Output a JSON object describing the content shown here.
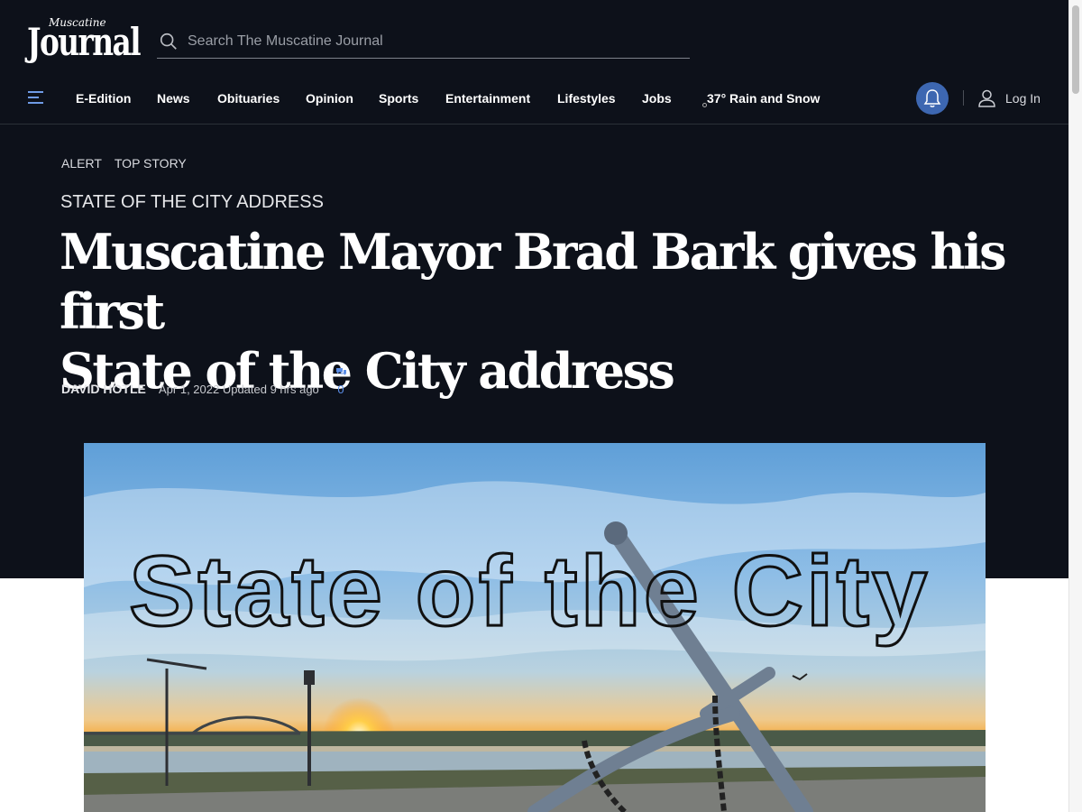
{
  "site": {
    "logo_small": "Muscatine",
    "logo_big": "Journal"
  },
  "search": {
    "placeholder": "Search The Muscatine Journal"
  },
  "nav": {
    "items": [
      "E-Edition",
      "News",
      "Obituaries",
      "Opinion",
      "Sports",
      "Entertainment",
      "Lifestyles",
      "Jobs"
    ],
    "weather": "37° Rain and Snow",
    "login_label": "Log In"
  },
  "article": {
    "tags": [
      "ALERT",
      "TOP STORY"
    ],
    "kicker": "STATE OF THE CITY ADDRESS",
    "headline_line1": "Muscatine Mayor Brad Bark gives his first",
    "headline_line2": "State of the City address",
    "author": "DAVID HOTLE",
    "date": "Apr 1, 2022 Updated 9 hrs ago",
    "comment_count": "0"
  },
  "hero": {
    "overlay_text": "State of the City"
  },
  "colors": {
    "header_bg": "#0d111a",
    "accent": "#3d67b1",
    "comment_link": "#5b8ee8"
  }
}
